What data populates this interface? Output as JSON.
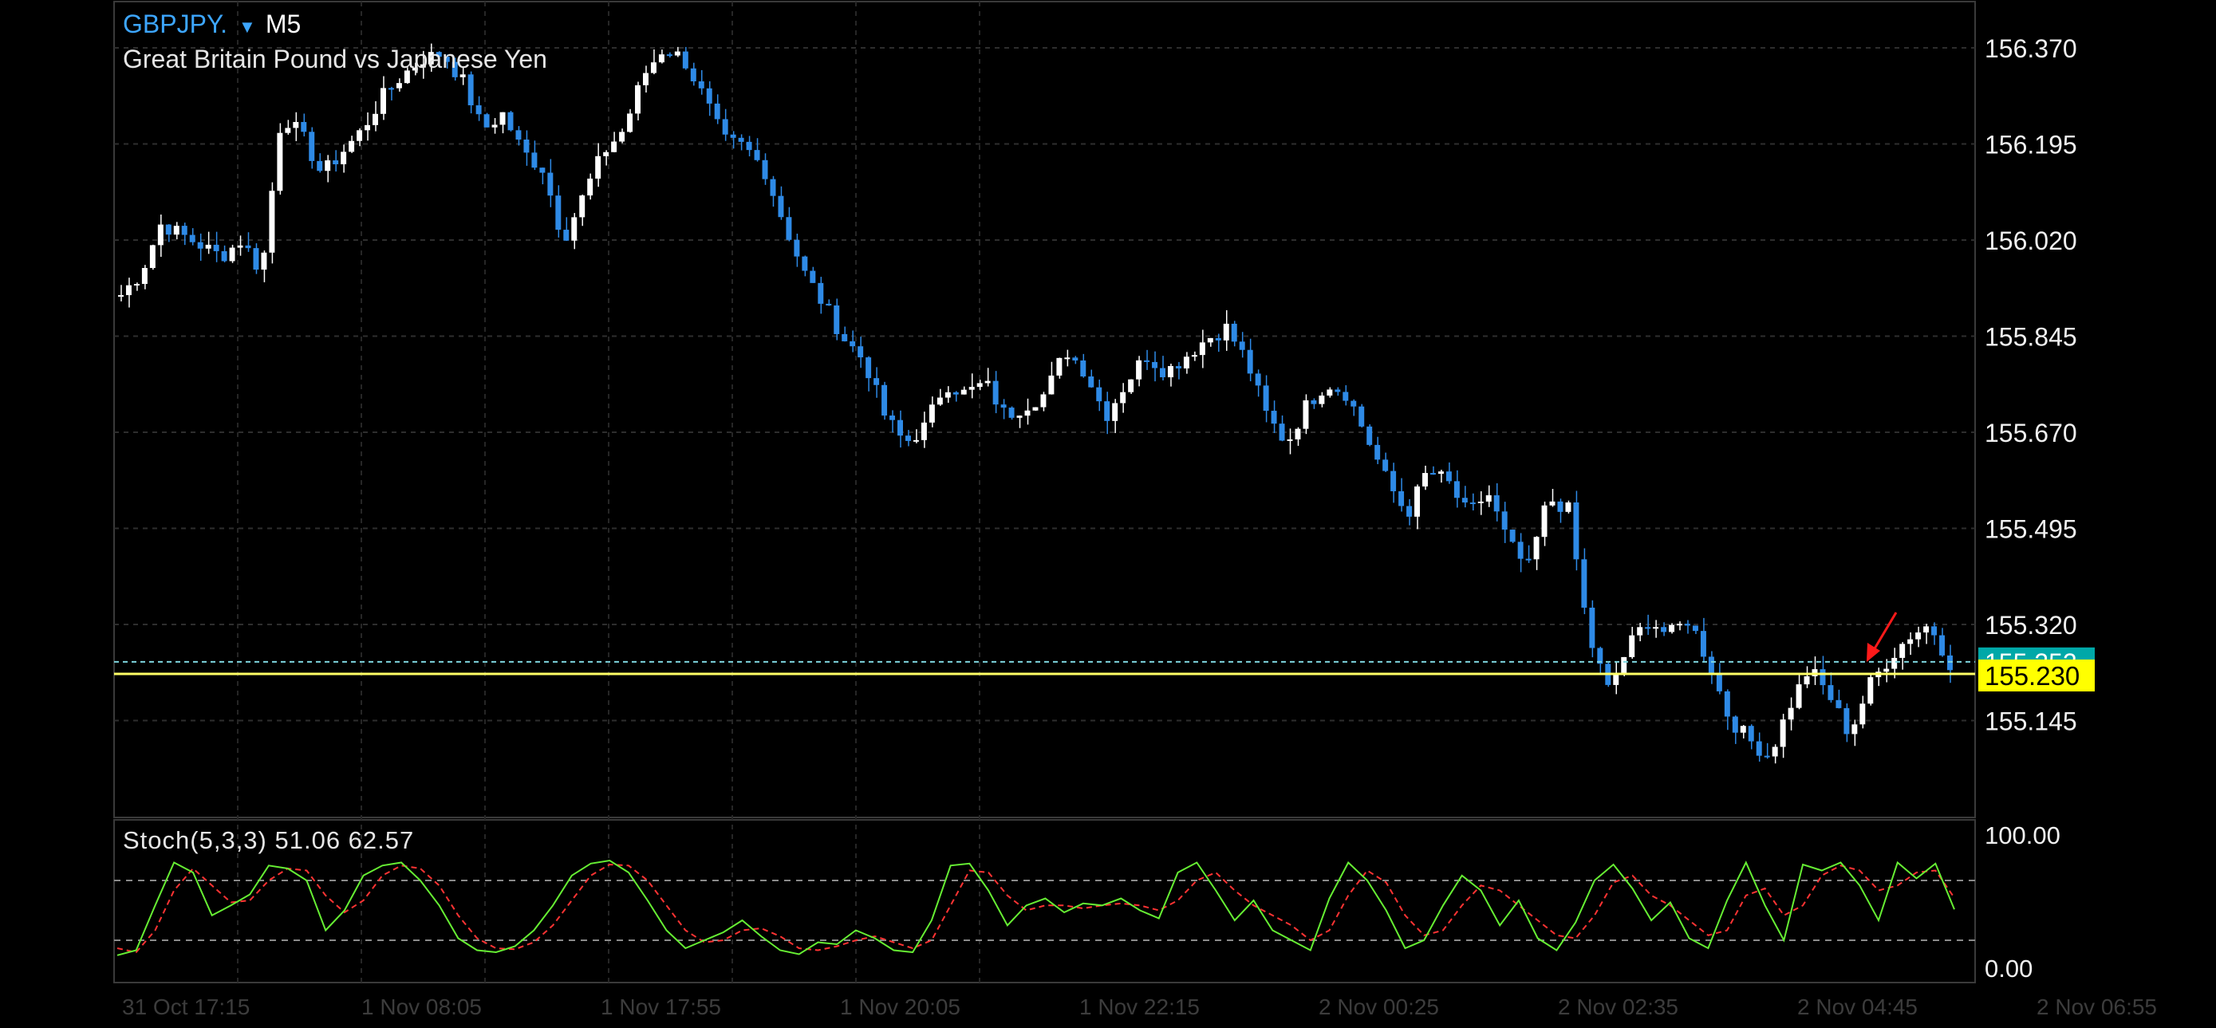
{
  "header": {
    "symbol": "GBPJPY.",
    "symbol_menu_icon": "caret-down-icon",
    "timeframe": "M5",
    "description": "Great Britain Pound vs Japanese Yen"
  },
  "price_axis": {
    "ticks": [
      "156.370",
      "156.195",
      "156.020",
      "155.845",
      "155.670",
      "155.495",
      "155.320",
      "155.145"
    ],
    "bid_tag": "155.252",
    "line_tag": "155.230"
  },
  "indicator": {
    "label": "Stoch(5,3,3) 51.06 62.57",
    "levels": [
      "100.00",
      "0.00"
    ]
  },
  "time_axis": {
    "labels": [
      "31 Oct 17:15",
      "1 Nov 08:05",
      "1 Nov 17:55",
      "1 Nov 20:05",
      "1 Nov 22:15",
      "2 Nov 00:25",
      "2 Nov 02:35",
      "2 Nov 04:45",
      "2 Nov 06:55"
    ]
  },
  "colors": {
    "bull": "#ffffff",
    "bear": "#2e8ae6",
    "bid_line": "#7fd6e0",
    "bid_tag_bg": "#00a8a8",
    "level_line": "#ffff66",
    "level_tag_bg": "#ffff00",
    "stoch_main": "#66ee33",
    "stoch_signal": "#ff3333",
    "arrow": "#ff1a1a"
  },
  "chart_data": {
    "type": "candlestick",
    "ylim": [
      155.05,
      156.43
    ],
    "close_path": [
      155.92,
      155.96,
      156.05,
      156.03,
      156.01,
      155.99,
      156.02,
      155.96,
      156.25,
      156.21,
      156.14,
      156.18,
      156.22,
      156.28,
      156.32,
      156.35,
      156.36,
      156.31,
      156.22,
      156.25,
      156.18,
      156.15,
      156.02,
      156.1,
      156.18,
      156.22,
      156.32,
      156.37,
      156.35,
      156.28,
      156.2,
      156.19,
      156.15,
      156.05,
      155.96,
      155.9,
      155.84,
      155.8,
      155.7,
      155.65,
      155.68,
      155.76,
      155.74,
      155.76,
      155.7,
      155.72,
      155.74,
      155.82,
      155.78,
      155.7,
      155.76,
      155.81,
      155.78,
      155.81,
      155.84,
      155.86,
      155.8,
      155.7,
      155.65,
      155.72,
      155.76,
      155.74,
      155.66,
      155.58,
      155.52,
      155.6,
      155.58,
      155.52,
      155.56,
      155.47,
      155.42,
      155.55,
      155.53,
      155.3,
      155.2,
      155.28,
      155.33,
      155.3,
      155.33,
      155.25,
      155.15,
      155.11,
      155.08,
      155.17,
      155.24,
      155.19,
      155.12,
      155.21,
      155.26,
      155.3,
      155.32,
      155.25
    ],
    "series": [
      {
        "name": "Stoch %K",
        "values": [
          5,
          10,
          55,
          98,
          88,
          45,
          55,
          66,
          95,
          92,
          80,
          30,
          50,
          85,
          95,
          98,
          80,
          55,
          22,
          10,
          8,
          14,
          30,
          55,
          85,
          97,
          100,
          88,
          60,
          30,
          12,
          20,
          28,
          40,
          24,
          10,
          6,
          18,
          16,
          30,
          22,
          10,
          8,
          40,
          95,
          97,
          70,
          35,
          55,
          62,
          48,
          57,
          55,
          62,
          50,
          42,
          88,
          98,
          70,
          40,
          60,
          30,
          20,
          10,
          62,
          98,
          80,
          50,
          12,
          20,
          55,
          85,
          70,
          35,
          60,
          22,
          10,
          38,
          80,
          96,
          72,
          40,
          58,
          22,
          12,
          60,
          98,
          55,
          20,
          96,
          90,
          98,
          75,
          40,
          98,
          82,
          97,
          51
        ]
      },
      {
        "name": "Stoch %D",
        "values": [
          12,
          8,
          30,
          70,
          92,
          75,
          58,
          60,
          80,
          92,
          90,
          65,
          48,
          60,
          85,
          95,
          92,
          75,
          45,
          22,
          12,
          11,
          18,
          35,
          60,
          85,
          96,
          95,
          80,
          55,
          30,
          18,
          20,
          30,
          32,
          24,
          12,
          10,
          14,
          20,
          24,
          18,
          12,
          20,
          55,
          90,
          88,
          65,
          50,
          55,
          55,
          52,
          55,
          57,
          55,
          50,
          60,
          80,
          88,
          70,
          55,
          45,
          35,
          20,
          30,
          65,
          90,
          78,
          45,
          25,
          30,
          55,
          75,
          70,
          55,
          40,
          25,
          22,
          45,
          78,
          85,
          65,
          55,
          40,
          25,
          30,
          65,
          72,
          45,
          55,
          85,
          95,
          90,
          70,
          75,
          88,
          90,
          62.57
        ]
      }
    ]
  }
}
